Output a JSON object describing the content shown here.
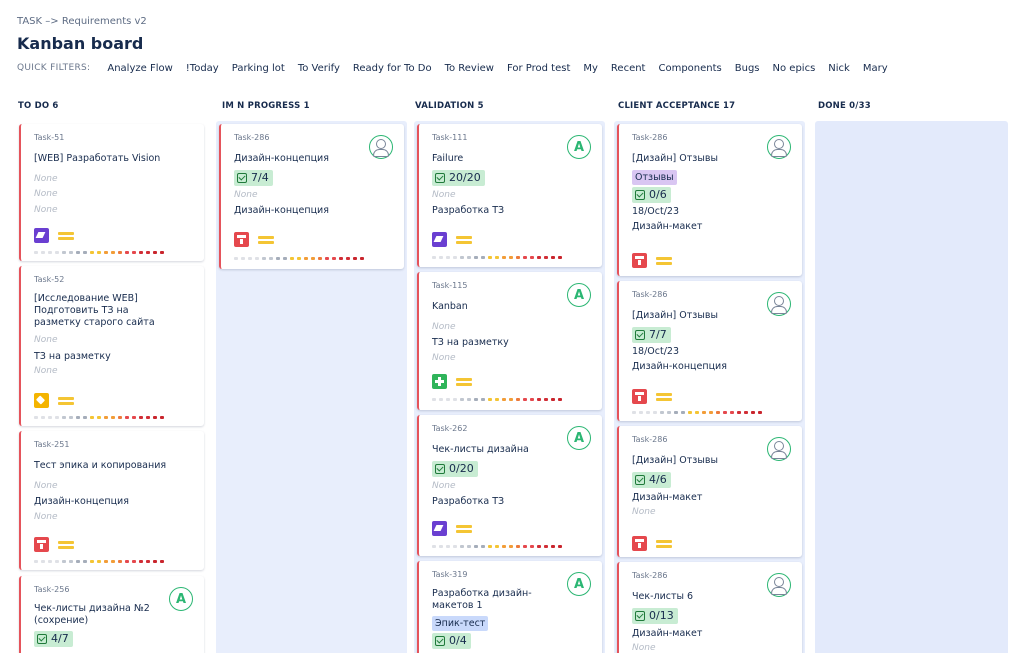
{
  "breadcrumb": "TASK –> Requirements v2",
  "page_title": "Kanban board",
  "quick_filters": {
    "label": "QUICK FILTERS:",
    "items": [
      "Analyze Flow",
      "!Today",
      "Parking lot",
      "To Verify",
      "Ready for To Do",
      "To Review",
      "For Prod test",
      "My",
      "Recent",
      "Components",
      "Bugs",
      "No epics",
      "Nick",
      "Mary"
    ]
  },
  "columns": [
    {
      "title": "TO DO 6",
      "cards": [
        {
          "key": "Task-51",
          "title": "[WEB] Разработать Vision",
          "lines": [
            "None",
            "None",
            "None"
          ],
          "type_icon": "story-icon"
        },
        {
          "key": "Task-52",
          "title": "[Исследование WEB] Подготовить ТЗ на разметку старого сайта",
          "lines": [
            "None",
            "ТЗ на разметку",
            "None"
          ],
          "type_icon": "tag-icon"
        },
        {
          "key": "Task-251",
          "title": "Тест эпика и копирования",
          "lines": [
            "None",
            "Дизайн-концепция",
            "None"
          ],
          "type_icon": "design-icon"
        },
        {
          "key": "Task-256",
          "title": "Чек-листы дизайна №2 (сохрение)",
          "progress": "4/7",
          "avatar": "A"
        }
      ]
    },
    {
      "title": "IM N PROGRESS 1",
      "cards": [
        {
          "key": "Task-286",
          "title": "Дизайн-концепция",
          "progress": "7/4",
          "lines": [
            "None",
            "Дизайн-концепция"
          ],
          "type_icon": "design-icon",
          "avatar": "person"
        }
      ]
    },
    {
      "title": "VALIDATION 5",
      "cards": [
        {
          "key": "Task-111",
          "title": "Failure",
          "progress": "20/20",
          "lines": [
            "None",
            "Разработка ТЗ"
          ],
          "type_icon": "story-icon",
          "avatar": "A"
        },
        {
          "key": "Task-115",
          "title": "Kanban",
          "lines": [
            "None",
            "ТЗ на разметку",
            "None"
          ],
          "type_icon": "plus-icon",
          "avatar": "A"
        },
        {
          "key": "Task-262",
          "title": "Чек-листы дизайна",
          "progress": "0/20",
          "lines": [
            "None",
            "Разработка ТЗ"
          ],
          "type_icon": "story-icon",
          "avatar": "A"
        },
        {
          "key": "Task-319",
          "title": "Разработка дизайн-макетов 1",
          "label": "Эпик-тест",
          "progress": "0/4",
          "avatar": "A"
        }
      ]
    },
    {
      "title": "CLIENT ACCEPTANCE 17",
      "cards": [
        {
          "key": "Task-286",
          "title": "[Дизайн] Отзывы",
          "label": "Отзывы",
          "progress": "0/6",
          "lines": [
            "18/Oct/23",
            "Дизайн-макет"
          ],
          "type_icon": "design-icon",
          "avatar": "person"
        },
        {
          "key": "Task-286",
          "title": "[Дизайн] Отзывы",
          "progress": "7/7",
          "lines": [
            "18/Oct/23",
            "Дизайн-концепция"
          ],
          "type_icon": "design-icon",
          "avatar": "person"
        },
        {
          "key": "Task-286",
          "title": "[Дизайн] Отзывы",
          "progress": "4/6",
          "lines": [
            "Дизайн-макет",
            "None"
          ],
          "type_icon": "design-icon",
          "avatar": "person"
        },
        {
          "key": "Task-286",
          "title": "Чек-листы 6",
          "progress": "0/13",
          "lines": [
            "Дизайн-макет",
            "None"
          ],
          "avatar": "person"
        }
      ]
    },
    {
      "title": "DONE 0/33",
      "cards": []
    }
  ],
  "colors": {
    "card_border": "#e5535b",
    "column_bg": "#e8eefc",
    "progress_bg": "#c8ecd3",
    "avatar_ring": "#2bb673",
    "priority": "#f4c534"
  }
}
